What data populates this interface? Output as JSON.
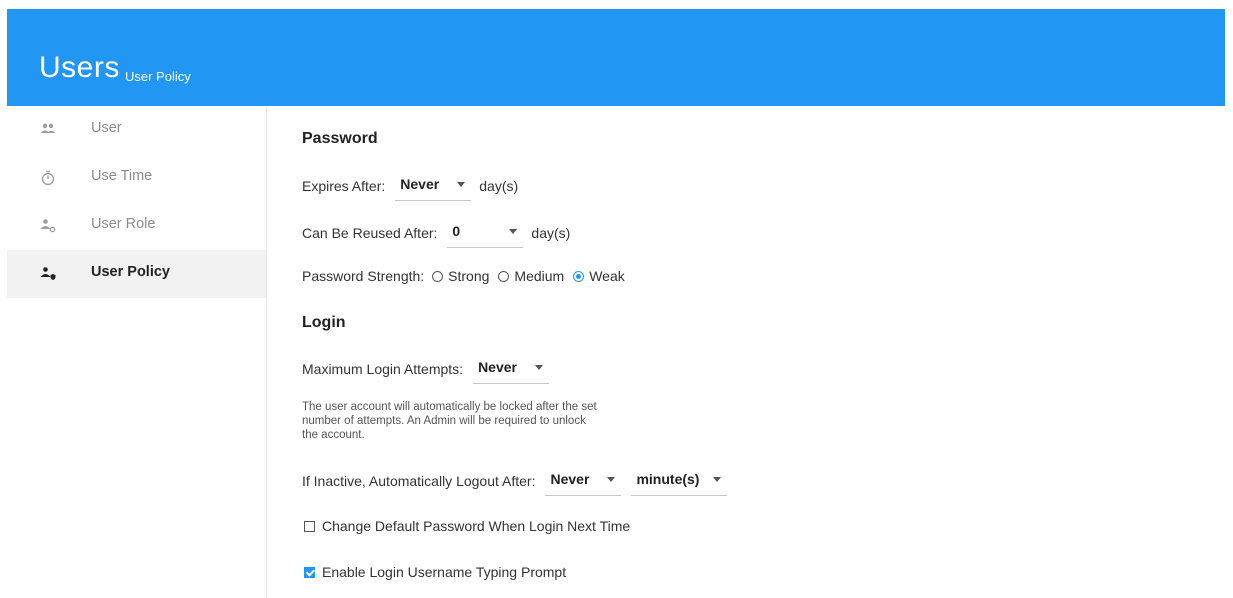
{
  "header": {
    "title": "Users",
    "subtitle": "User Policy"
  },
  "colors": {
    "accent": "#2196f3",
    "active_bg": "#f2f2f2"
  },
  "sidebar": {
    "items": [
      {
        "label": "User",
        "icon": "users-icon",
        "active": false
      },
      {
        "label": "Use Time",
        "icon": "stopwatch-icon",
        "active": false
      },
      {
        "label": "User Role",
        "icon": "user-gear-icon",
        "active": false
      },
      {
        "label": "User Policy",
        "icon": "user-shield-icon",
        "active": true
      }
    ]
  },
  "password": {
    "section_title": "Password",
    "expires": {
      "label": "Expires After:",
      "value": "Never",
      "unit": "day(s)"
    },
    "reuse": {
      "label": "Can Be Reused After:",
      "value": "0",
      "unit": "day(s)"
    },
    "strength": {
      "label": "Password Strength:",
      "options": [
        "Strong",
        "Medium",
        "Weak"
      ],
      "selected": "Weak"
    }
  },
  "login": {
    "section_title": "Login",
    "max_attempts": {
      "label": "Maximum Login Attempts:",
      "value": "Never"
    },
    "help_text": "The user account will automatically be locked after the set number of attempts. An Admin will be required to unlock the account.",
    "inactive": {
      "label": "If Inactive, Automatically Logout After:",
      "value": "Never",
      "unit_value": "minute(s)"
    },
    "change_default_password": {
      "label": "Change Default Password When Login Next Time",
      "checked": false
    },
    "username_prompt": {
      "label": "Enable Login Username Typing Prompt",
      "checked": true
    }
  }
}
